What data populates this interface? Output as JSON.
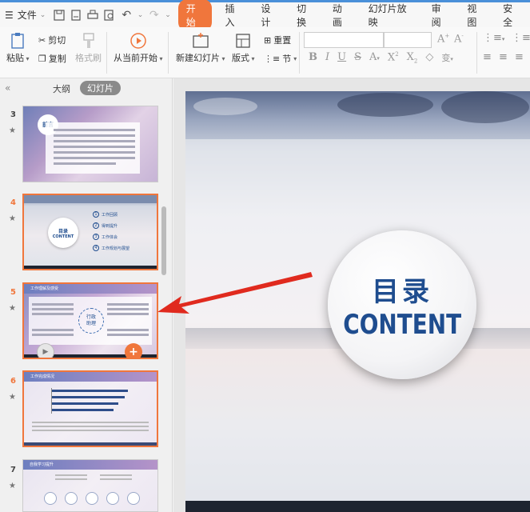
{
  "menu": {
    "file_label": "文件",
    "tabs": [
      "开始",
      "插入",
      "设计",
      "切换",
      "动画",
      "幻灯片放映",
      "审阅",
      "视图",
      "安全"
    ]
  },
  "ribbon": {
    "paste": "粘贴",
    "cut": "剪切",
    "copy": "复制",
    "format_painter": "格式刷",
    "play_from_current": "从当前开始",
    "new_slide": "新建幻灯片",
    "layout": "版式",
    "reset": "重置",
    "section": "节"
  },
  "panel": {
    "tab_outline": "大纲",
    "tab_slides": "幻灯片",
    "slides": [
      {
        "number": "3",
        "title": "前言"
      },
      {
        "number": "4",
        "title": "目录",
        "subtitle": "CONTENT",
        "items": [
          "工作回顾",
          "得到提升",
          "工作体会",
          "工作规划与展望"
        ]
      },
      {
        "number": "5",
        "title": "工作理解及感受",
        "center": "行政助理"
      },
      {
        "number": "6",
        "title": "工作完成情况"
      },
      {
        "number": "7",
        "title": "自我学习提升"
      }
    ]
  },
  "slide": {
    "title": "目录",
    "subtitle": "CONTENT"
  },
  "colors": {
    "accent": "#f0763c",
    "title_blue": "#1f4d8f",
    "arrow": "#e02a1e"
  }
}
